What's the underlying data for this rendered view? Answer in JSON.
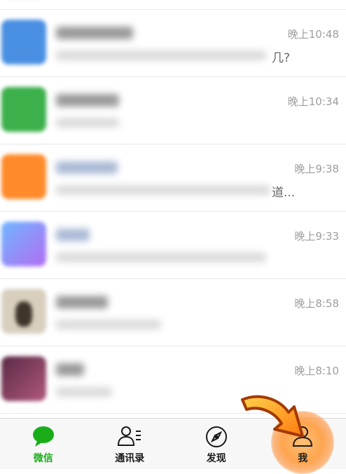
{
  "chats": [
    {
      "time": "晚上10:48",
      "tail": "几?",
      "avatar_color": "#4a90e2"
    },
    {
      "time": "晚上10:34",
      "tail": "",
      "avatar_color": "#3cb04b"
    },
    {
      "time": "晚上9:38",
      "tail": "道...",
      "avatar_color": "#ff8a2a"
    },
    {
      "time": "晚上9:33",
      "tail": "",
      "avatar_color": "#9a7bf0"
    },
    {
      "time": "晚上8:58",
      "tail": "",
      "avatar_color": "#6b5a48"
    },
    {
      "time": "晚上8:10",
      "tail": "",
      "avatar_color": "#8a3a5e"
    }
  ],
  "tabbar": {
    "chats": "微信",
    "contacts": "通讯录",
    "discover": "发现",
    "me": "我"
  },
  "colors": {
    "accent": "#1aad19",
    "highlight": "#ff8a20"
  }
}
